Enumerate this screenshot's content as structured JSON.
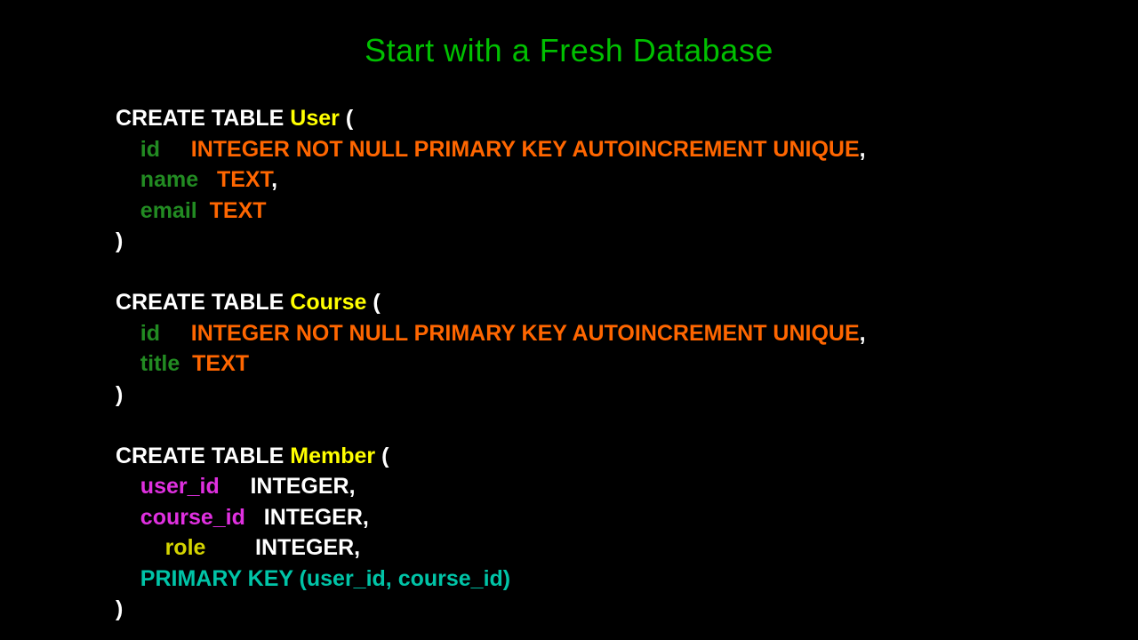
{
  "title": "Start with a Fresh Database",
  "code": {
    "user": {
      "create": "CREATE TABLE ",
      "tableName": "User",
      "openParen": " (",
      "id_col": "id",
      "id_type": "INTEGER NOT NULL PRIMARY KEY AUTOINCREMENT UNIQUE",
      "comma": ",",
      "name_col": "name",
      "name_type": "TEXT",
      "email_col": "email",
      "email_type": "TEXT",
      "closeParen": ")"
    },
    "course": {
      "create": "CREATE TABLE ",
      "tableName": "Course",
      "openParen": " (",
      "id_col": "id",
      "id_type": "INTEGER NOT NULL PRIMARY KEY AUTOINCREMENT UNIQUE",
      "comma": ",",
      "title_col": "title",
      "title_type": "TEXT",
      "closeParen": ")"
    },
    "member": {
      "create": "CREATE TABLE ",
      "tableName": "Member",
      "openParen": " (",
      "userid_col": "user_id",
      "userid_type": "INTEGER,",
      "courseid_col": "course_id",
      "courseid_type": "INTEGER,",
      "role_col": "role",
      "role_type": "INTEGER,",
      "pk": "PRIMARY KEY (user_id, course_id)",
      "closeParen": ")"
    }
  }
}
